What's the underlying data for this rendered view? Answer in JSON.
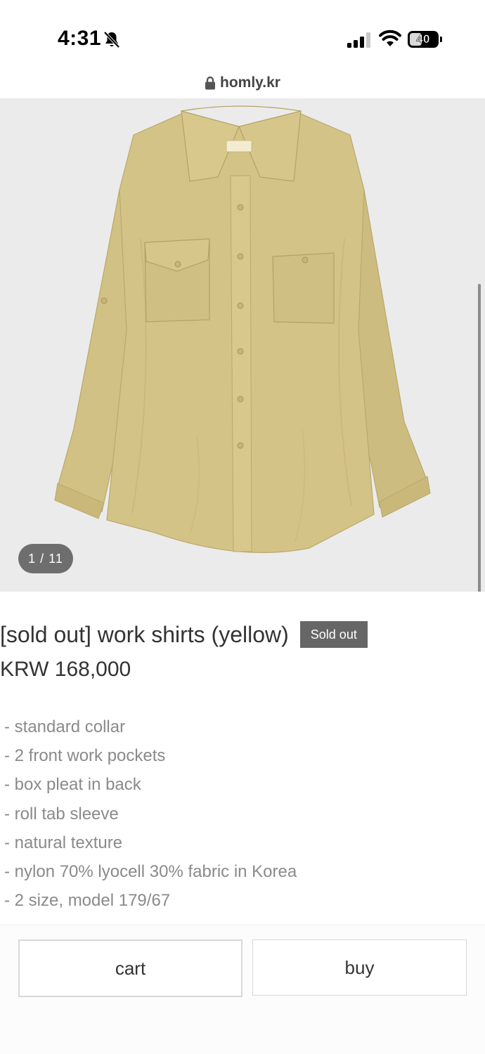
{
  "status_bar": {
    "time": "4:31",
    "battery": "40",
    "icons": [
      "bell-off-icon",
      "signal-icon",
      "wifi-icon",
      "battery-icon"
    ]
  },
  "browser": {
    "url": "homly.kr",
    "icons": [
      "lock-icon"
    ]
  },
  "gallery": {
    "counter": "1 / 11",
    "image_subject": "yellow work shirt"
  },
  "product": {
    "title": "[sold out] work shirts (yellow)",
    "badge": "Sold out",
    "price": "KRW 168,000",
    "details": [
      "- standard collar",
      "- 2 front work pockets",
      "- box pleat in back",
      "- roll tab sleeve",
      "- natural texture",
      "- nylon 70% lyocell 30% fabric in Korea",
      "- 2 size, model 179/67"
    ]
  },
  "actions": {
    "cart_label": "cart",
    "buy_label": "buy"
  },
  "colors": {
    "shirt": "#d2c184",
    "badge_bg": "#666666",
    "gallery_bg": "#ebebeb"
  }
}
